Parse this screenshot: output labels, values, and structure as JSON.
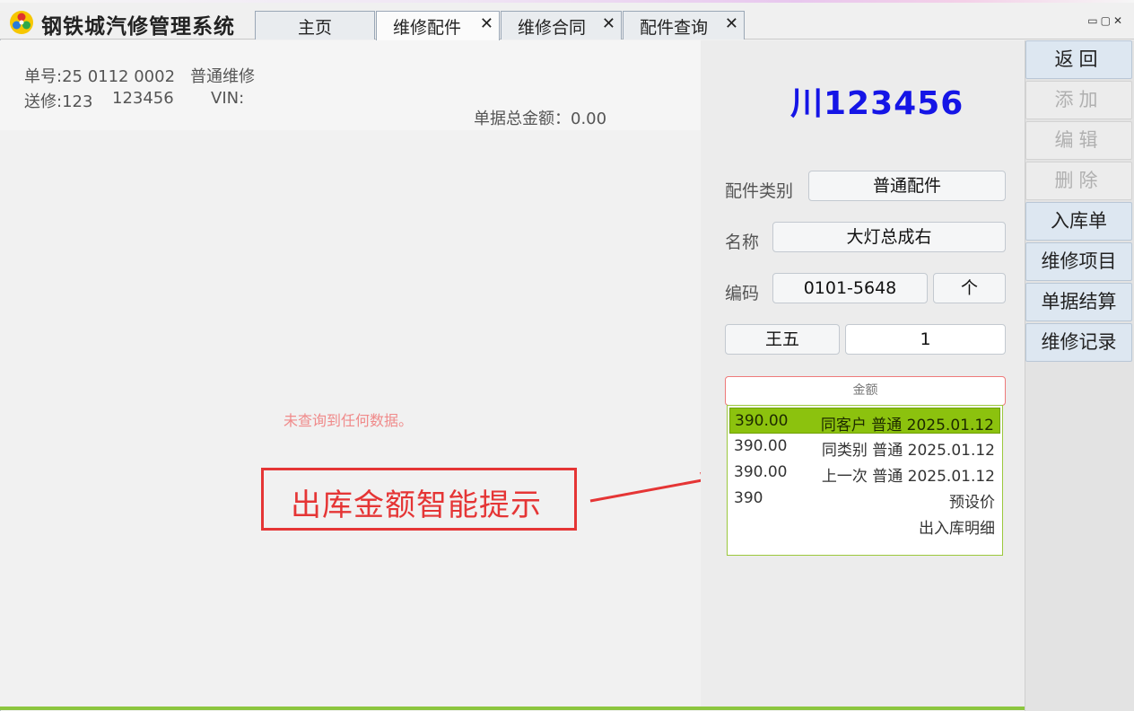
{
  "app": {
    "title": "钢铁城汽修管理系统"
  },
  "tabs": [
    {
      "label": "主页",
      "closable": false
    },
    {
      "label": "维修配件",
      "closable": true,
      "active": true
    },
    {
      "label": "维修合同",
      "closable": true
    },
    {
      "label": "配件查询",
      "closable": true
    }
  ],
  "tab_close_glyph": "✕",
  "window_controls": "▭▢✕",
  "order": {
    "number": "单号:25 0112 0002",
    "type": "普通维修",
    "sender": "送修:123",
    "phone": "123456",
    "vin": "VIN:",
    "total": "单据总金额：0.00"
  },
  "empty_message": "未查询到任何数据。",
  "callout": "出库金额智能提示",
  "vehicle": {
    "plate": "川123456"
  },
  "form": {
    "category_label": "配件类别",
    "category_value": "普通配件",
    "name_label": "名称",
    "name_value": "大灯总成右",
    "code_label": "编码",
    "code_value": "0101-5648",
    "unit_value": "个",
    "person_value": "王五",
    "quantity_value": "1",
    "amount_placeholder": "金额"
  },
  "suggestions": [
    {
      "amount": "390.00",
      "desc": "同客户 普通 2025.01.12",
      "selected": true
    },
    {
      "amount": "390.00",
      "desc": "同类别 普通 2025.01.12"
    },
    {
      "amount": "390.00",
      "desc": "上一次 普通 2025.01.12"
    },
    {
      "amount": "390",
      "desc": "预设价"
    },
    {
      "amount": "",
      "desc": "出入库明细"
    }
  ],
  "sidebar": {
    "buttons": [
      {
        "label": "返回",
        "enabled": true
      },
      {
        "label": "添加",
        "enabled": false
      },
      {
        "label": "编辑",
        "enabled": false
      },
      {
        "label": "删除",
        "enabled": false
      },
      {
        "label": "入库单",
        "enabled": true
      },
      {
        "label": "维修项目",
        "enabled": true
      },
      {
        "label": "单据结算",
        "enabled": true
      },
      {
        "label": "维修记录",
        "enabled": true
      }
    ]
  },
  "colors": {
    "plate": "#1515e6",
    "callout": "#e53535",
    "highlight": "#8cc20e",
    "button": "#dde7f1"
  }
}
